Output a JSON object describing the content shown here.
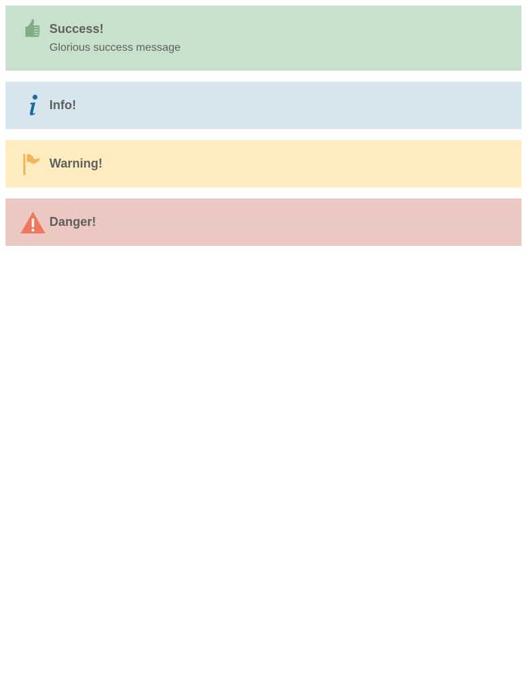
{
  "colors": {
    "success_bg": "#c8e1cc",
    "success_icon": "#7fad88",
    "info_bg": "#d6e5ee",
    "info_icon": "#1b6b9e",
    "warning_bg": "#ffedc0",
    "warning_icon": "#f6b55c",
    "danger_bg": "#ecc8c3",
    "danger_icon": "#ef7860",
    "text": "#5f5f5f"
  },
  "alerts": [
    {
      "type": "success",
      "icon": "thumbs-up-icon",
      "title": "Success!",
      "message": "Glorious success message"
    },
    {
      "type": "info",
      "icon": "info-icon",
      "title": "Info!"
    },
    {
      "type": "warning",
      "icon": "flag-icon",
      "title": "Warning!"
    },
    {
      "type": "danger",
      "icon": "warning-triangle-icon",
      "title": "Danger!"
    }
  ]
}
